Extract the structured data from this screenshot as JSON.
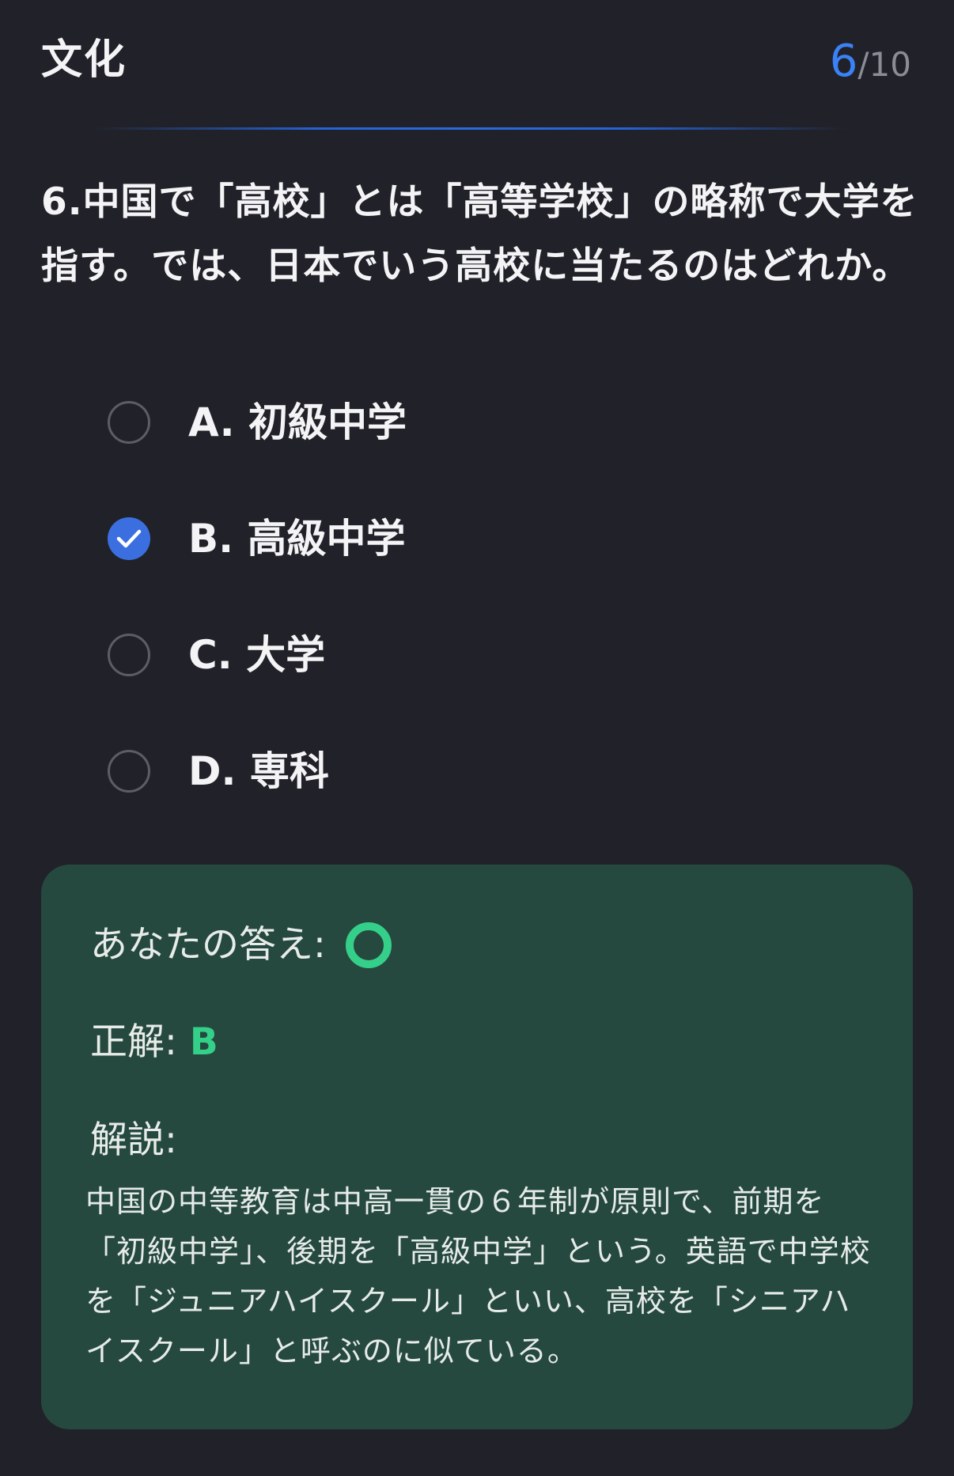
{
  "header": {
    "category": "文化",
    "progress_current": "6",
    "progress_separator": "/",
    "progress_total": "10"
  },
  "question": {
    "text": "6.中国で「高校」とは「高等学校」の略称で大学を指す。では、日本でいう高校に当たるのはどれか。"
  },
  "options": [
    {
      "label": "A. 初級中学",
      "selected": false
    },
    {
      "label": "B. 高級中学",
      "selected": true
    },
    {
      "label": "C. 大学",
      "selected": false
    },
    {
      "label": "D. 専科",
      "selected": false
    }
  ],
  "result": {
    "your_answer_label": "あなたの答え:",
    "your_answer_icon": "correct-circle-icon",
    "correct_label": "正解:",
    "correct_value": "B",
    "explanation_label": "解説:",
    "explanation_text": "中国の中等教育は中高一貫の６年制が原則で、前期を「初級中学」、後期を「高級中学」という。英語で中学校を「ジュニアハイスクール」といい、高校を「シニアハイスクール」と呼ぶのに似ている。"
  },
  "colors": {
    "background": "#212229",
    "accent_blue": "#3b82f6",
    "card_green": "#25493f",
    "correct_green": "#34d08a"
  }
}
